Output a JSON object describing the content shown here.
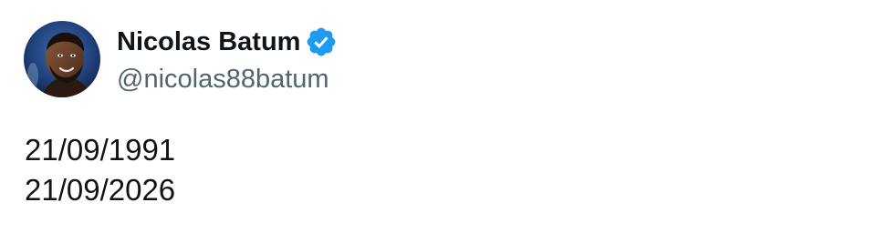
{
  "tweet": {
    "author": {
      "name": "Nicolas Batum",
      "handle": "@nicolas88batum",
      "verified": true
    },
    "text_lines": [
      "21/09/1991",
      "21/09/2026"
    ]
  },
  "colors": {
    "verified_badge": "#1d9bf0",
    "handle_text": "#536471",
    "body_text": "#0f1419"
  }
}
